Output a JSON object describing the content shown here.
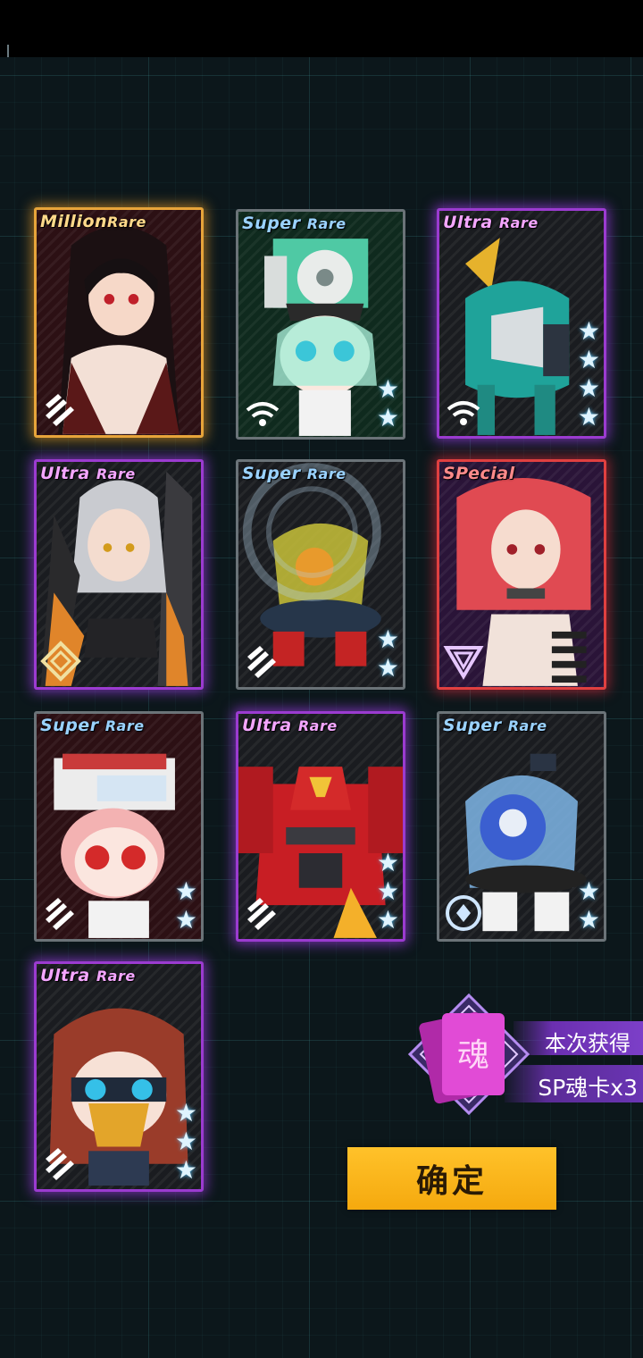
{
  "cards": [
    {
      "rarity_main": "Million",
      "rarity_sub": "Rare",
      "stars": 0
    },
    {
      "rarity_main": "Super",
      "rarity_sub": "Rare",
      "stars": 2
    },
    {
      "rarity_main": "Ultra",
      "rarity_sub": "Rare",
      "stars": 4
    },
    {
      "rarity_main": "Ultra",
      "rarity_sub": "Rare",
      "stars": 0
    },
    {
      "rarity_main": "Super",
      "rarity_sub": "Rare",
      "stars": 2
    },
    {
      "rarity_main": "SPecial",
      "rarity_sub": "",
      "stars": 0
    },
    {
      "rarity_main": "Super",
      "rarity_sub": "Rare",
      "stars": 2
    },
    {
      "rarity_main": "Ultra",
      "rarity_sub": "Rare",
      "stars": 3
    },
    {
      "rarity_main": "Super",
      "rarity_sub": "Rare",
      "stars": 2
    },
    {
      "rarity_main": "Ultra",
      "rarity_sub": "Rare",
      "stars": 3
    }
  ],
  "soul": {
    "icon_char": "魂",
    "label": "本次获得",
    "value": "SP魂卡x3"
  },
  "confirm_label": "确定",
  "colors": {
    "gold": "#e7a43a",
    "purple": "#9b3bd0",
    "red": "#e04040",
    "button": "#ffc22a"
  }
}
